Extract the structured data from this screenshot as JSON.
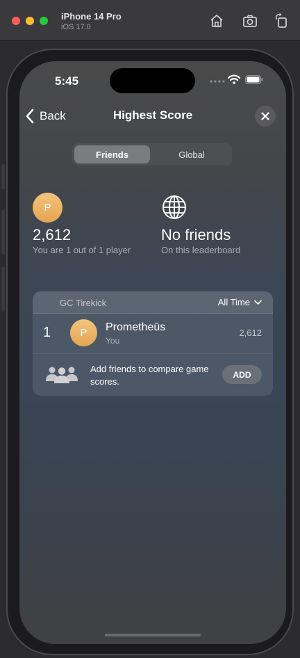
{
  "simulator": {
    "device_name": "iPhone 14 Pro",
    "os_version": "iOS 17.0",
    "toolbar_icons": [
      "home-icon",
      "screenshot-icon",
      "rotate-icon"
    ]
  },
  "status_bar": {
    "time": "5:45",
    "icons": [
      "signal-dots-icon",
      "wifi-icon",
      "battery-icon"
    ]
  },
  "nav": {
    "back_label": "Back",
    "title": "Highest Score",
    "close_icon": "close-icon"
  },
  "segmented": {
    "options": [
      "Friends",
      "Global"
    ],
    "selected": "Friends"
  },
  "summary": {
    "avatar_initial": "P",
    "score": "2,612",
    "rank_text": "You are 1 out of 1 player",
    "friends_title": "No friends",
    "friends_sub": "On this leaderboard",
    "friends_icon": "globe-icon"
  },
  "leaderboard": {
    "name": "GC Tirekick",
    "filter": "All Time",
    "rows": [
      {
        "rank": "1",
        "initial": "P",
        "name": "Prometheūs",
        "sub": "You",
        "score": "2,612"
      }
    ],
    "invite_text": "Add friends to compare game scores.",
    "add_label": "ADD"
  },
  "colors": {
    "avatar_gradient_top": "#f3c47d",
    "avatar_gradient_bottom": "#e5a452",
    "selected_segment": "#7b7c7f"
  }
}
